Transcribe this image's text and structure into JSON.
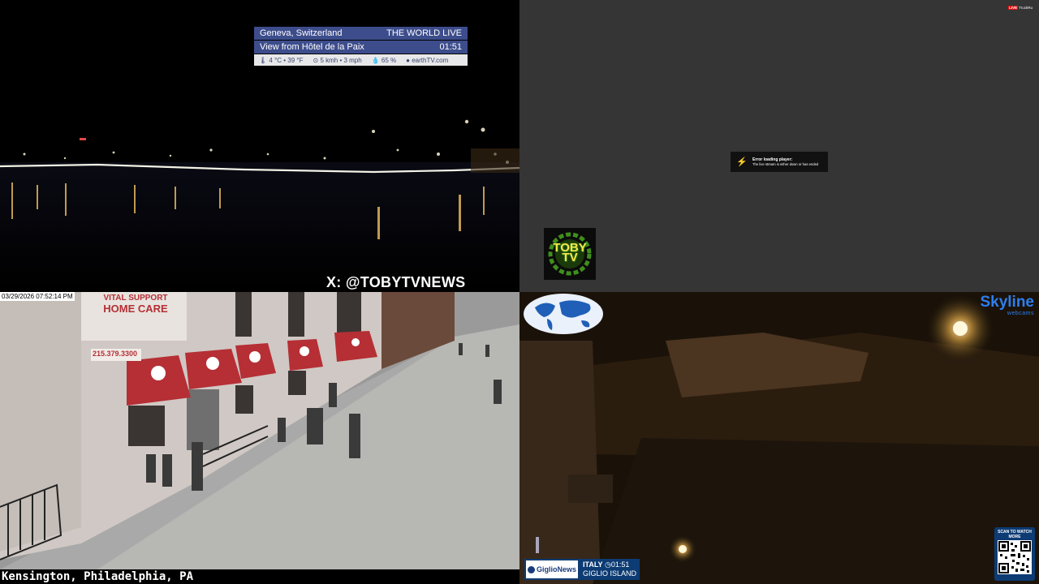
{
  "geneva": {
    "location": "Geneva, Switzerland",
    "brand": "THE WORLD LIVE",
    "view": "View from Hôtel de la Paix",
    "time": "01:51",
    "temperature": "4 °C • 39 °F",
    "wind": "5 kmh • 3 mph",
    "humidity": "65 %",
    "site": "earthTV.com",
    "handle": "X: @TOBYTVNEWS"
  },
  "error_player": {
    "title": "Error loading player:",
    "message": "The live stream is either down or has ended",
    "live_badge": "LIVE",
    "channel": "TruckRu",
    "logo_text": "TOBY TV",
    "bg_color": "#353535"
  },
  "kensington": {
    "timestamp": "03/29/2026 07:52:14 PM",
    "caption": "Kensington, Philadelphia, PA",
    "sign_top": "VITAL SUPPORT",
    "sign_main": "HOME CARE",
    "phone": "215.379.3300"
  },
  "giglio": {
    "skyline_brand": "Skyline",
    "skyline_sub": "webcams",
    "news_logo": "GiglioNews",
    "country": "ITALY",
    "time": "01:51",
    "place": "GIGLIO ISLAND",
    "qr_label": "SCAN TO WATCH MORE",
    "brand_color": "#2c7ff0"
  }
}
